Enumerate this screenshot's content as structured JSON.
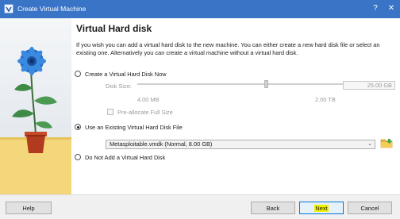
{
  "window": {
    "title": "Create Virtual Machine",
    "help_glyph": "?",
    "close_glyph": "✕"
  },
  "page": {
    "heading": "Virtual Hard disk",
    "description": "If you wish you can add a virtual hard disk to the new machine. You can either create a new hard disk file or select an existing one. Alternatively you can create a virtual machine without a virtual hard disk."
  },
  "options": {
    "create_new": {
      "label": "Create a Virtual Hard Disk Now",
      "selected": false
    },
    "use_existing": {
      "label": "Use an Existing Virtual Hard Disk File",
      "selected": true
    },
    "no_disk": {
      "label": "Do Not Add a Virtual Hard Disk",
      "selected": false
    }
  },
  "disk_size": {
    "label": "Disk Size:",
    "value": "25.00 GB",
    "min_label": "4.00 MB",
    "max_label": "2.00 TB",
    "slider_fraction": 0.55
  },
  "preallocate": {
    "label": "Pre-allocate Full Size",
    "checked": false
  },
  "existing_file": {
    "selected": "Metasploitable.vmdk (Normal, 8.00 GB)",
    "arrow_glyph": "⌄"
  },
  "buttons": {
    "help": "Help",
    "back": "Back",
    "next": "Next",
    "cancel": "Cancel"
  },
  "colors": {
    "titlebar": "#3974c7",
    "highlight": "#f4f000",
    "default_button_border": "#0078d7"
  },
  "icons": [
    "virtualbox-icon",
    "flower-pot-illustration",
    "folder-icon"
  ]
}
